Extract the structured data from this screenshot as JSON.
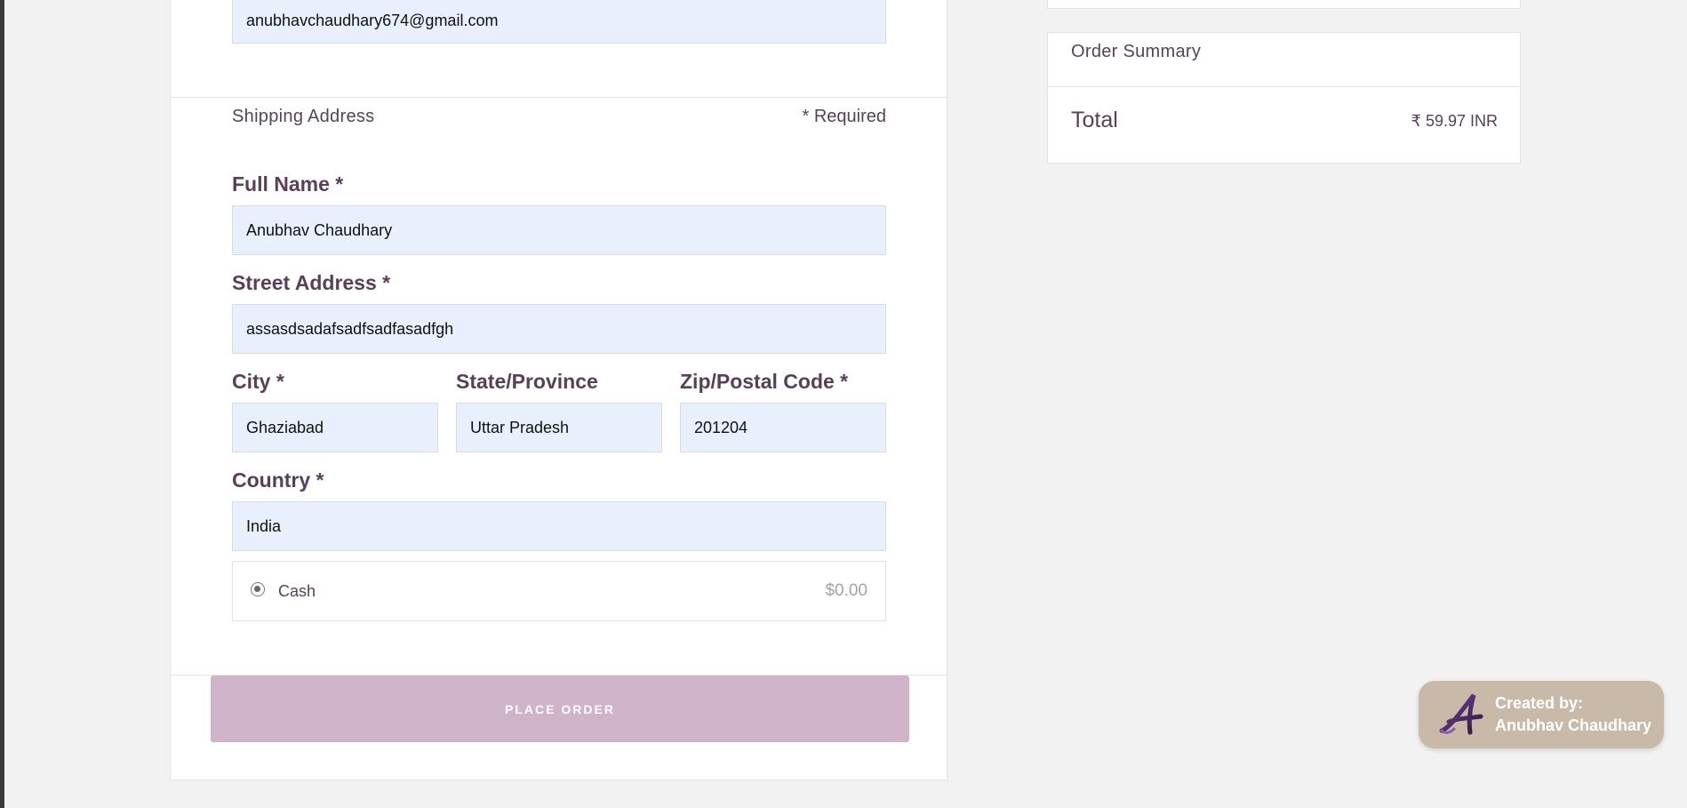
{
  "contact": {
    "email_value": "anubhavchaudhary674@gmail.com"
  },
  "shipping": {
    "section_title": "Shipping Address",
    "required_note": "* Required",
    "full_name_label": "Full Name *",
    "full_name_value": "Anubhav Chaudhary",
    "street_label": "Street Address *",
    "street_value": "assasdsadafsadfsadfasadfgh",
    "city_label": "City *",
    "city_value": "Ghaziabad",
    "state_label": "State/Province",
    "state_value": "Uttar Pradesh",
    "zip_label": "Zip/Postal Code *",
    "zip_value": "201204",
    "country_label": "Country *",
    "country_value": "India"
  },
  "payment": {
    "method_label": "Cash",
    "method_price": "$0.00",
    "selected": true
  },
  "actions": {
    "place_order_label": "PLACE ORDER"
  },
  "summary": {
    "title": "Order Summary",
    "total_label": "Total",
    "total_value": "₹ 59.97 INR"
  },
  "credit": {
    "line1": "Created by:",
    "line2": "Anubhav Chaudhary",
    "logo_icon": "script-a-logo-icon"
  },
  "colors": {
    "text": "#5a3f5a",
    "input_bg": "#e8effd",
    "button": "#cfb3c9",
    "badge": "#c9b9a8"
  }
}
